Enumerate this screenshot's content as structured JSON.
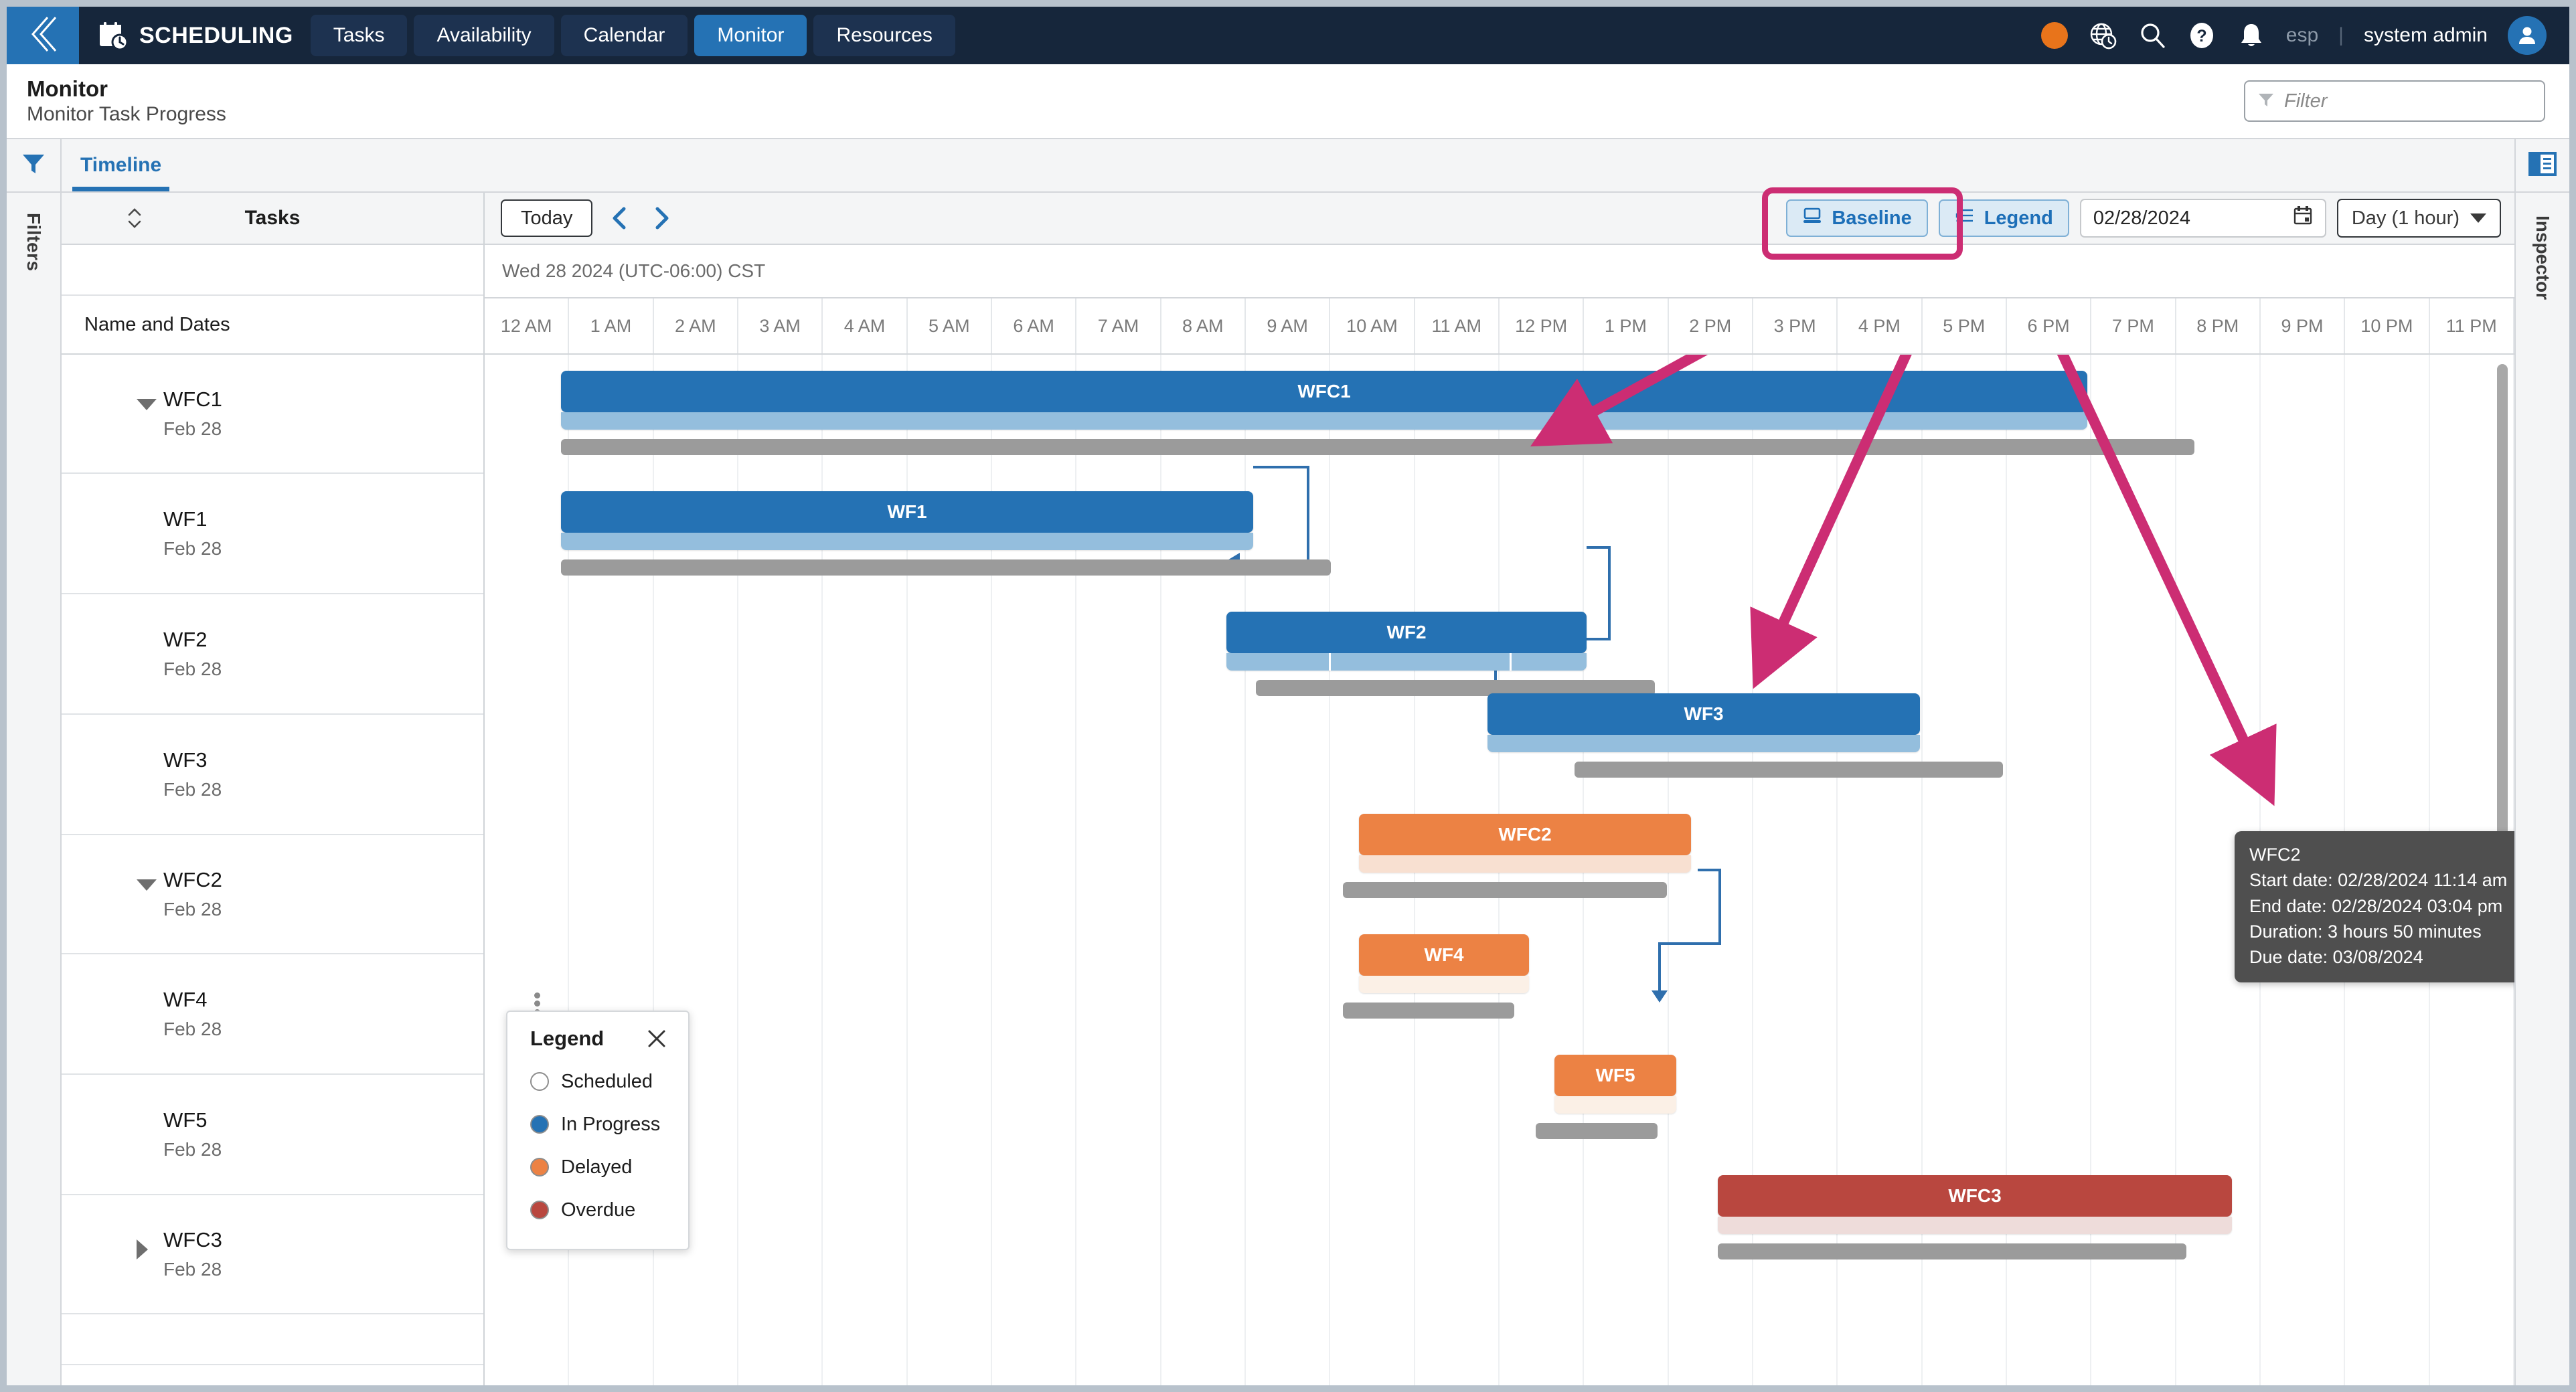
{
  "topnav": {
    "back_icon": "chevron-double-left-icon",
    "brand_icon": "calendar-clock-icon",
    "brand": "SCHEDULING",
    "tabs": [
      {
        "label": "Tasks",
        "active": false
      },
      {
        "label": "Availability",
        "active": false
      },
      {
        "label": "Calendar",
        "active": false
      },
      {
        "label": "Monitor",
        "active": true
      },
      {
        "label": "Resources",
        "active": false
      }
    ],
    "status_dot_color": "#e8741b",
    "icons": [
      "globe-clock-icon",
      "search-icon",
      "help-icon",
      "bell-icon"
    ],
    "language": "esp",
    "separator": "|",
    "user": "system admin",
    "avatar_icon": "user-avatar-icon"
  },
  "pageheader": {
    "title": "Monitor",
    "subtitle": "Monitor Task Progress",
    "filter": {
      "icon": "funnel-icon",
      "placeholder": "Filter",
      "value": ""
    }
  },
  "left_rail": {
    "icon": "funnel-icon",
    "label": "Filters"
  },
  "right_rail": {
    "icon": "inspector-panel-icon",
    "label": "Inspector"
  },
  "tabbar": {
    "tabs": [
      {
        "label": "Timeline",
        "active": true
      }
    ]
  },
  "taskpane": {
    "header": "Tasks",
    "sort_icon": "sort-updown-icon",
    "column_header": "Name and Dates",
    "rows": [
      {
        "name": "WFC1",
        "date": "Feb 28",
        "level": 0,
        "expanded": true
      },
      {
        "name": "WF1",
        "date": "Feb 28",
        "level": 1,
        "expanded": null
      },
      {
        "name": "WF2",
        "date": "Feb 28",
        "level": 1,
        "expanded": null
      },
      {
        "name": "WF3",
        "date": "Feb 28",
        "level": 1,
        "expanded": null
      },
      {
        "name": "WFC2",
        "date": "Feb 28",
        "level": 0,
        "expanded": true
      },
      {
        "name": "WF4",
        "date": "Feb 28",
        "level": 1,
        "expanded": null
      },
      {
        "name": "WF5",
        "date": "Feb 28",
        "level": 1,
        "expanded": null
      },
      {
        "name": "WFC3",
        "date": "Feb 28",
        "level": 0,
        "expanded": false
      }
    ]
  },
  "toolbar": {
    "today_label": "Today",
    "prev_icon": "chevron-left-icon",
    "next_icon": "chevron-right-icon",
    "baseline_label": "Baseline",
    "baseline_icon": "baseline-monitor-icon",
    "legend_label": "Legend",
    "legend_icon": "legend-list-icon",
    "date_value": "02/28/2024",
    "calendar_icon": "calendar-icon",
    "zoom_value": "Day (1 hour)",
    "zoom_caret_icon": "chevron-down-icon",
    "highlight_color": "#cc2d73"
  },
  "timeline": {
    "date_header": "Wed 28 2024 (UTC-06:00) CST",
    "hours": [
      "12 AM",
      "1 AM",
      "2 AM",
      "3 AM",
      "4 AM",
      "5 AM",
      "6 AM",
      "7 AM",
      "8 AM",
      "9 AM",
      "10 AM",
      "11 AM",
      "12 PM",
      "1 PM",
      "2 PM",
      "3 PM",
      "4 PM",
      "5 PM",
      "6 PM",
      "7 PM",
      "8 PM",
      "9 PM",
      "10 PM",
      "11 PM"
    ]
  },
  "chart_data": {
    "type": "gantt",
    "title": "Monitor Task Progress",
    "date": "02/28/2024",
    "timezone": "(UTC-06:00) CST",
    "axis_unit": "1 hour",
    "axis_range": [
      "12 AM",
      "11 PM"
    ],
    "status_colors": {
      "scheduled": "#ffffff",
      "in_progress": "#2572b4",
      "delayed": "#ec8244",
      "overdue": "#b9473f"
    },
    "baseline_color": "#9b9b9b",
    "tasks": [
      {
        "name": "WFC1",
        "status": "in_progress",
        "level": 0,
        "start_hour": 1.15,
        "end_hour": 16.45,
        "label_shown": true,
        "baseline_start": 1.15,
        "baseline_end": 17.75,
        "progress_segments": [
          [
            0,
            1.0
          ]
        ]
      },
      {
        "name": "WF1",
        "status": "in_progress",
        "level": 1,
        "start_hour": 1.15,
        "end_hour": 8.6,
        "label_shown": true,
        "baseline_start": 1.15,
        "baseline_end": 8.6,
        "progress_segments": [
          [
            0,
            1.0
          ]
        ]
      },
      {
        "name": "WF2",
        "status": "in_progress",
        "level": 1,
        "start_hour": 9.0,
        "end_hour": 12.4,
        "label_shown": true,
        "baseline_start": 9.15,
        "baseline_end": 12.9,
        "progress_segments": [
          [
            0,
            0.29
          ],
          [
            0.29,
            0.79
          ],
          [
            0.79,
            1.0
          ]
        ]
      },
      {
        "name": "WF3",
        "status": "in_progress",
        "level": 1,
        "start_hour": 12.9,
        "end_hour": 16.45,
        "label_shown": true,
        "baseline_start": 13.6,
        "baseline_end": 17.9,
        "progress_segments": [
          [
            0,
            1.0
          ]
        ]
      },
      {
        "name": "WFC2",
        "status": "delayed",
        "level": 0,
        "start_hour": 10.0,
        "end_hour": 13.85,
        "label_shown": true,
        "baseline_start": 9.9,
        "baseline_end": 13.6,
        "progress_segments": [
          [
            0,
            1.0
          ]
        ]
      },
      {
        "name": "WF4",
        "status": "delayed",
        "level": 1,
        "start_hour": 10.0,
        "end_hour": 12.0,
        "label_shown": true,
        "baseline_start": 9.9,
        "baseline_end": 11.8,
        "progress_segments": [
          [
            0,
            1.0
          ]
        ]
      },
      {
        "name": "WF5",
        "status": "delayed",
        "level": 1,
        "start_hour": 12.4,
        "end_hour": 13.85,
        "label_shown": true,
        "baseline_start": 12.6,
        "baseline_end": 14.1,
        "progress_segments": [
          [
            0,
            1.0
          ]
        ]
      },
      {
        "name": "WFC3",
        "status": "overdue",
        "level": 0,
        "start_hour": 13.8,
        "end_hour": 18.9,
        "label_shown": true,
        "baseline_start": 13.8,
        "baseline_end": 18.5,
        "progress_segments": [
          [
            0,
            1.0
          ]
        ]
      }
    ],
    "dependencies": [
      {
        "from": "WF1",
        "to": "WF2"
      },
      {
        "from": "WF2",
        "to": "WF3"
      },
      {
        "from": "WF4",
        "to": "WF5"
      }
    ]
  },
  "tooltip": {
    "title": "WFC2",
    "lines": [
      "Start date: 02/28/2024 11:14 am",
      "End date: 02/28/2024 03:04 pm",
      "Duration: 3 hours 50 minutes",
      "Due date: 03/08/2024"
    ]
  },
  "legend_panel": {
    "title": "Legend",
    "close_icon": "close-icon",
    "items": [
      {
        "label": "Scheduled",
        "color": "#ffffff"
      },
      {
        "label": "In Progress",
        "color": "#2572b4"
      },
      {
        "label": "Delayed",
        "color": "#ec8244"
      },
      {
        "label": "Overdue",
        "color": "#b9473f"
      }
    ]
  },
  "annotations": {
    "callout_color": "#cc2d73",
    "description": "Pink highlight around Baseline button with three arrows pointing to baseline bars"
  }
}
